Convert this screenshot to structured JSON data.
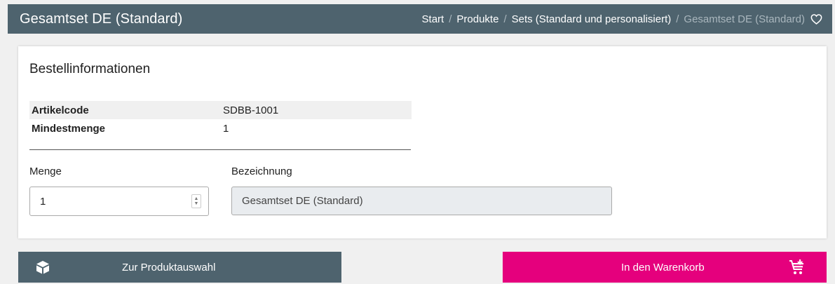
{
  "header": {
    "title": "Gesamtset DE (Standard)",
    "breadcrumb": {
      "items": [
        "Start",
        "Produkte",
        "Sets (Standard und personalisiert)"
      ],
      "current": "Gesamtset DE (Standard)",
      "separator": "/"
    },
    "favorite_icon": "heart-outline-icon"
  },
  "order_info": {
    "heading": "Bestellinformationen",
    "rows": [
      {
        "key": "Artikelcode",
        "value": "SDBB-1001"
      },
      {
        "key": "Mindestmenge",
        "value": "1"
      }
    ],
    "quantity_label": "Menge",
    "quantity_value": "1",
    "name_label": "Bezeichnung",
    "name_value": "Gesamtset DE (Standard)"
  },
  "actions": {
    "back_label": "Zur Produktauswahl",
    "back_icon": "box-icon",
    "cart_label": "In den Warenkorb",
    "cart_icon": "cart-add-icon"
  },
  "colors": {
    "header_bg": "#4e636e",
    "accent": "#e5007d",
    "page_bg": "#f0f0f0"
  }
}
